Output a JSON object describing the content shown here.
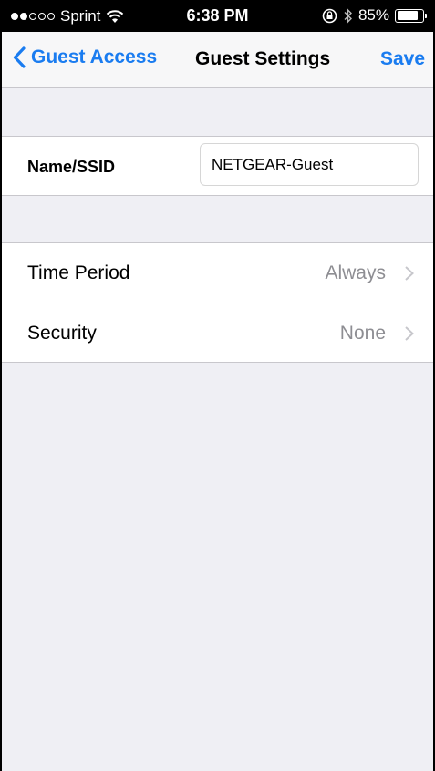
{
  "status_bar": {
    "carrier": "Sprint",
    "time": "6:38 PM",
    "battery": "85%",
    "battery_level": 0.85,
    "signal_bars_filled": 2,
    "signal_bars_total": 5,
    "icons": [
      "wifi-icon",
      "rotation-lock-icon",
      "bluetooth-icon",
      "battery-icon"
    ]
  },
  "nav": {
    "back_label": "Guest Access",
    "title": "Guest Settings",
    "save_label": "Save",
    "accent_color": "#1a7cf0"
  },
  "ssid": {
    "label": "Name/SSID",
    "value": "NETGEAR-Guest"
  },
  "settings": [
    {
      "label": "Time Period",
      "value": "Always"
    },
    {
      "label": "Security",
      "value": "None"
    }
  ]
}
